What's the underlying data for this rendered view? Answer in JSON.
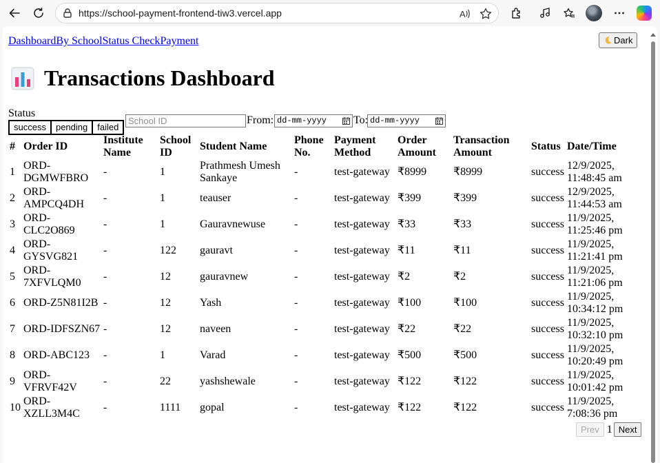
{
  "browser": {
    "url": "https://school-payment-frontend-tiw3.vercel.app"
  },
  "nav": {
    "links": [
      "Dashboard",
      "By School",
      "Status Check",
      "Payment"
    ],
    "dark_button": "Dark"
  },
  "header": {
    "title": "Transactions Dashboard",
    "icon": "bar-chart-icon"
  },
  "filters": {
    "status_label": "Status",
    "status_options": [
      "success",
      "pending",
      "failed"
    ],
    "school_placeholder": "School ID",
    "from_label": "From:",
    "to_label": "To:",
    "date_placeholder": "dd-mm-yyyy"
  },
  "table": {
    "headers": [
      "#",
      "Order ID",
      "Institute Name",
      "School ID",
      "Student Name",
      "Phone No.",
      "Payment Method",
      "Order Amount",
      "Transaction Amount",
      "Status",
      "Date/Time"
    ],
    "rows": [
      [
        "1",
        "ORD-DGMWFBRO",
        "-",
        "1",
        "Prathmesh Umesh Sankaye",
        "-",
        "test-gateway",
        "₹8999",
        "₹8999",
        "success",
        "12/9/2025, 11:48:45 am"
      ],
      [
        "2",
        "ORD-AMPCQ4DH",
        "-",
        "1",
        "teauser",
        "-",
        "test-gateway",
        "₹399",
        "₹399",
        "success",
        "12/9/2025, 11:44:53 am"
      ],
      [
        "3",
        "ORD-CLC2O869",
        "-",
        "1",
        "Gauravnewuse",
        "-",
        "test-gateway",
        "₹33",
        "₹33",
        "success",
        "11/9/2025, 11:25:46 pm"
      ],
      [
        "4",
        "ORD-GYSVG821",
        "-",
        "122",
        "gauravt",
        "-",
        "test-gateway",
        "₹11",
        "₹11",
        "success",
        "11/9/2025, 11:21:41 pm"
      ],
      [
        "5",
        "ORD-7XFVLQM0",
        "-",
        "12",
        "gauravnew",
        "-",
        "test-gateway",
        "₹2",
        "₹2",
        "success",
        "11/9/2025, 11:21:06 pm"
      ],
      [
        "6",
        "ORD-Z5N81I2B",
        "-",
        "12",
        "Yash",
        "-",
        "test-gateway",
        "₹100",
        "₹100",
        "success",
        "11/9/2025, 10:34:12 pm"
      ],
      [
        "7",
        "ORD-IDFSZN67",
        "-",
        "12",
        "naveen",
        "-",
        "test-gateway",
        "₹22",
        "₹22",
        "success",
        "11/9/2025, 10:32:10 pm"
      ],
      [
        "8",
        "ORD-ABC123",
        "-",
        "1",
        "Varad",
        "-",
        "test-gateway",
        "₹500",
        "₹500",
        "success",
        "11/9/2025, 10:20:49 pm"
      ],
      [
        "9",
        "ORD-VFRVF42V",
        "-",
        "22",
        "yashshewale",
        "-",
        "test-gateway",
        "₹122",
        "₹122",
        "success",
        "11/9/2025, 10:01:42 pm"
      ],
      [
        "10",
        "ORD-XZLL3M4C",
        "-",
        "1111",
        "gopal",
        "-",
        "test-gateway",
        "₹122",
        "₹122",
        "success",
        "11/9/2025, 7:08:36 pm"
      ]
    ]
  },
  "pagination": {
    "prev": "Prev",
    "page": "1",
    "next": "Next"
  }
}
